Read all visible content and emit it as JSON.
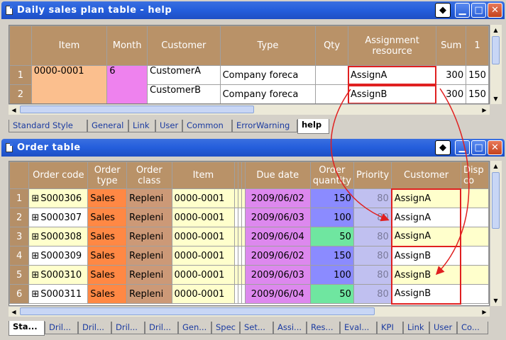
{
  "colors": {
    "title_bar": "#245edc",
    "header": "#b99268",
    "item_orange": "#fbbf8e",
    "month_pink": "#ee82ee",
    "due_pink": "#dd88ee",
    "qty_blue": "#8b8bff",
    "qty_green": "#6fe6a0",
    "sales_orange": "#ff8844",
    "class_brown": "#cc9977",
    "cream": "#ffffcc",
    "highlight_red": "#e02020"
  },
  "plan": {
    "title": "Daily sales plan table - help",
    "columns": [
      "Item",
      "Month",
      "Customer",
      "Type",
      "Qty",
      "Assignment resource",
      "Sum",
      "1"
    ],
    "rows": [
      {
        "num": "1",
        "item": "0000-0001",
        "month": "6",
        "customer": "CustomerA",
        "type": "Company foreca",
        "qty": "",
        "resource": "AssignA",
        "sum": "300",
        "d1": "150"
      },
      {
        "num": "2",
        "item": "",
        "month": "",
        "customer": "CustomerB",
        "type": "Company foreca",
        "qty": "",
        "resource": "AssignB",
        "sum": "300",
        "d1": "150"
      }
    ],
    "tabs": [
      "Standard Style",
      "General",
      "Link",
      "User",
      "Common",
      "ErrorWarning",
      "help"
    ],
    "active_tab": "help"
  },
  "order": {
    "title": "Order table",
    "columns": [
      "Order code",
      "Order type",
      "Order class",
      "Item",
      "Due date",
      "Order quantity",
      "Priority",
      "Customer",
      "Disp co"
    ],
    "rows": [
      {
        "num": "1",
        "code": "S000306",
        "otype": "Sales",
        "oclass": "Repleni",
        "item": "0000-0001",
        "due": "2009/06/02",
        "qty": "150",
        "prio": "80",
        "customer": "AssignA"
      },
      {
        "num": "2",
        "code": "S000307",
        "otype": "Sales",
        "oclass": "Repleni",
        "item": "0000-0001",
        "due": "2009/06/03",
        "qty": "100",
        "prio": "80",
        "customer": "AssignA"
      },
      {
        "num": "3",
        "code": "S000308",
        "otype": "Sales",
        "oclass": "Repleni",
        "item": "0000-0001",
        "due": "2009/06/04",
        "qty": "50",
        "prio": "80",
        "customer": "AssignA"
      },
      {
        "num": "4",
        "code": "S000309",
        "otype": "Sales",
        "oclass": "Repleni",
        "item": "0000-0001",
        "due": "2009/06/02",
        "qty": "150",
        "prio": "80",
        "customer": "AssignB"
      },
      {
        "num": "5",
        "code": "S000310",
        "otype": "Sales",
        "oclass": "Repleni",
        "item": "0000-0001",
        "due": "2009/06/03",
        "qty": "100",
        "prio": "80",
        "customer": "AssignB"
      },
      {
        "num": "6",
        "code": "S000311",
        "otype": "Sales",
        "oclass": "Repleni",
        "item": "0000-0001",
        "due": "2009/06/04",
        "qty": "50",
        "prio": "80",
        "customer": "AssignB"
      }
    ],
    "tabs": [
      "Sta...",
      "Dril...",
      "Dril...",
      "Dril...",
      "Dril...",
      "Gen...",
      "Spec",
      "Set...",
      "Assi...",
      "Res...",
      "Eval...",
      "KPI",
      "Link",
      "User",
      "Co..."
    ],
    "active_tab": "Sta..."
  }
}
